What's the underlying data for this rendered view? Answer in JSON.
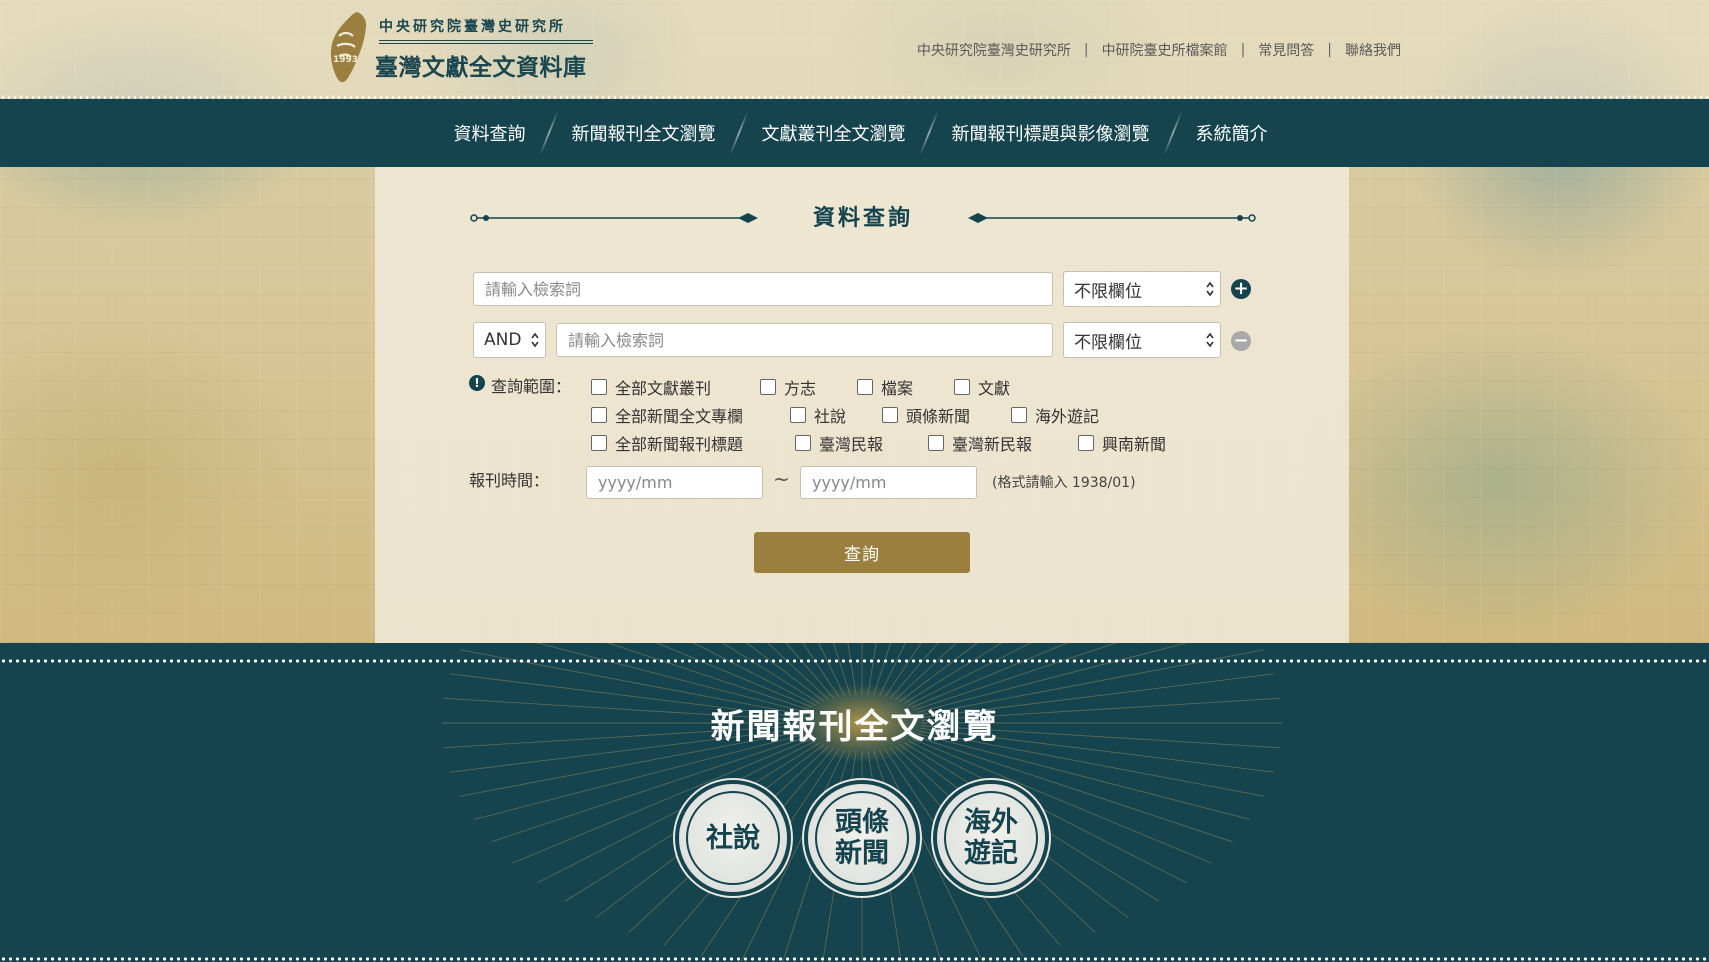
{
  "header": {
    "institute": "中央研究院臺灣史研究所",
    "database_title": "臺灣文獻全文資料庫",
    "logo_year": "1993",
    "links": [
      {
        "label": "中央研究院臺灣史研究所"
      },
      {
        "label": "中研院臺史所檔案館"
      },
      {
        "label": "常見問答"
      },
      {
        "label": "聯絡我們"
      }
    ],
    "separator": "|"
  },
  "nav": {
    "items": [
      {
        "label": "資料查詢"
      },
      {
        "label": "新聞報刊全文瀏覽"
      },
      {
        "label": "文獻叢刊全文瀏覽"
      },
      {
        "label": "新聞報刊標題與影像瀏覽"
      },
      {
        "label": "系統簡介"
      }
    ]
  },
  "search": {
    "title": "資料查詢",
    "placeholder": "請輸入檢索詞",
    "field_select_value": "不限欄位",
    "operator_value": "AND",
    "add_row": "+",
    "remove_row": "−",
    "scope_label": "查詢範圍：",
    "scope_info": "!",
    "scope_options": [
      {
        "label": "全部文獻叢刊",
        "checked": false
      },
      {
        "label": "方志",
        "checked": false
      },
      {
        "label": "檔案",
        "checked": false
      },
      {
        "label": "文獻",
        "checked": false
      },
      {
        "label": "全部新聞全文專欄",
        "checked": false
      },
      {
        "label": "社說",
        "checked": false
      },
      {
        "label": "頭條新聞",
        "checked": false
      },
      {
        "label": "海外遊記",
        "checked": false
      },
      {
        "label": "全部新聞報刊標題",
        "checked": false
      },
      {
        "label": "臺灣民報",
        "checked": false
      },
      {
        "label": "臺灣新民報",
        "checked": false
      },
      {
        "label": "興南新聞",
        "checked": false
      }
    ],
    "date_label": "報刊時間：",
    "date_placeholder": "yyyy/mm",
    "date_separator": "~",
    "date_hint": "(格式請輸入 1938/01)",
    "submit_label": "查詢"
  },
  "browse": {
    "title": "新聞報刊全文瀏覽",
    "seals": [
      {
        "line1": "社說",
        "line2": ""
      },
      {
        "line1": "頭條",
        "line2": "新聞"
      },
      {
        "line1": "海外",
        "line2": "遊記"
      }
    ]
  },
  "colors": {
    "primary": "#15434e",
    "accent_gold": "#9b7f3f",
    "add_button": "#15434e",
    "remove_button": "#a9a9a9"
  },
  "icons": [
    "taiwan-seal-logo-icon",
    "plus-circle-icon",
    "minus-circle-icon",
    "info-icon",
    "select-arrows-icon"
  ]
}
